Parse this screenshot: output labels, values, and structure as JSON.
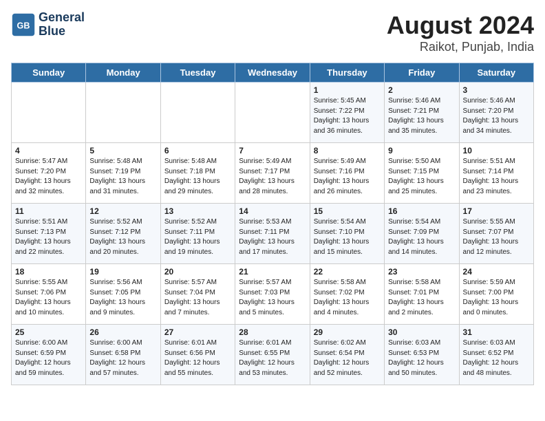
{
  "header": {
    "logo_line1": "General",
    "logo_line2": "Blue",
    "title": "August 2024",
    "subtitle": "Raikot, Punjab, India"
  },
  "weekdays": [
    "Sunday",
    "Monday",
    "Tuesday",
    "Wednesday",
    "Thursday",
    "Friday",
    "Saturday"
  ],
  "weeks": [
    [
      {
        "day": "",
        "sunrise": "",
        "sunset": "",
        "daylight": ""
      },
      {
        "day": "",
        "sunrise": "",
        "sunset": "",
        "daylight": ""
      },
      {
        "day": "",
        "sunrise": "",
        "sunset": "",
        "daylight": ""
      },
      {
        "day": "",
        "sunrise": "",
        "sunset": "",
        "daylight": ""
      },
      {
        "day": "1",
        "sunrise": "Sunrise: 5:45 AM",
        "sunset": "Sunset: 7:22 PM",
        "daylight": "Daylight: 13 hours and 36 minutes."
      },
      {
        "day": "2",
        "sunrise": "Sunrise: 5:46 AM",
        "sunset": "Sunset: 7:21 PM",
        "daylight": "Daylight: 13 hours and 35 minutes."
      },
      {
        "day": "3",
        "sunrise": "Sunrise: 5:46 AM",
        "sunset": "Sunset: 7:20 PM",
        "daylight": "Daylight: 13 hours and 34 minutes."
      }
    ],
    [
      {
        "day": "4",
        "sunrise": "Sunrise: 5:47 AM",
        "sunset": "Sunset: 7:20 PM",
        "daylight": "Daylight: 13 hours and 32 minutes."
      },
      {
        "day": "5",
        "sunrise": "Sunrise: 5:48 AM",
        "sunset": "Sunset: 7:19 PM",
        "daylight": "Daylight: 13 hours and 31 minutes."
      },
      {
        "day": "6",
        "sunrise": "Sunrise: 5:48 AM",
        "sunset": "Sunset: 7:18 PM",
        "daylight": "Daylight: 13 hours and 29 minutes."
      },
      {
        "day": "7",
        "sunrise": "Sunrise: 5:49 AM",
        "sunset": "Sunset: 7:17 PM",
        "daylight": "Daylight: 13 hours and 28 minutes."
      },
      {
        "day": "8",
        "sunrise": "Sunrise: 5:49 AM",
        "sunset": "Sunset: 7:16 PM",
        "daylight": "Daylight: 13 hours and 26 minutes."
      },
      {
        "day": "9",
        "sunrise": "Sunrise: 5:50 AM",
        "sunset": "Sunset: 7:15 PM",
        "daylight": "Daylight: 13 hours and 25 minutes."
      },
      {
        "day": "10",
        "sunrise": "Sunrise: 5:51 AM",
        "sunset": "Sunset: 7:14 PM",
        "daylight": "Daylight: 13 hours and 23 minutes."
      }
    ],
    [
      {
        "day": "11",
        "sunrise": "Sunrise: 5:51 AM",
        "sunset": "Sunset: 7:13 PM",
        "daylight": "Daylight: 13 hours and 22 minutes."
      },
      {
        "day": "12",
        "sunrise": "Sunrise: 5:52 AM",
        "sunset": "Sunset: 7:12 PM",
        "daylight": "Daylight: 13 hours and 20 minutes."
      },
      {
        "day": "13",
        "sunrise": "Sunrise: 5:52 AM",
        "sunset": "Sunset: 7:11 PM",
        "daylight": "Daylight: 13 hours and 19 minutes."
      },
      {
        "day": "14",
        "sunrise": "Sunrise: 5:53 AM",
        "sunset": "Sunset: 7:11 PM",
        "daylight": "Daylight: 13 hours and 17 minutes."
      },
      {
        "day": "15",
        "sunrise": "Sunrise: 5:54 AM",
        "sunset": "Sunset: 7:10 PM",
        "daylight": "Daylight: 13 hours and 15 minutes."
      },
      {
        "day": "16",
        "sunrise": "Sunrise: 5:54 AM",
        "sunset": "Sunset: 7:09 PM",
        "daylight": "Daylight: 13 hours and 14 minutes."
      },
      {
        "day": "17",
        "sunrise": "Sunrise: 5:55 AM",
        "sunset": "Sunset: 7:07 PM",
        "daylight": "Daylight: 13 hours and 12 minutes."
      }
    ],
    [
      {
        "day": "18",
        "sunrise": "Sunrise: 5:55 AM",
        "sunset": "Sunset: 7:06 PM",
        "daylight": "Daylight: 13 hours and 10 minutes."
      },
      {
        "day": "19",
        "sunrise": "Sunrise: 5:56 AM",
        "sunset": "Sunset: 7:05 PM",
        "daylight": "Daylight: 13 hours and 9 minutes."
      },
      {
        "day": "20",
        "sunrise": "Sunrise: 5:57 AM",
        "sunset": "Sunset: 7:04 PM",
        "daylight": "Daylight: 13 hours and 7 minutes."
      },
      {
        "day": "21",
        "sunrise": "Sunrise: 5:57 AM",
        "sunset": "Sunset: 7:03 PM",
        "daylight": "Daylight: 13 hours and 5 minutes."
      },
      {
        "day": "22",
        "sunrise": "Sunrise: 5:58 AM",
        "sunset": "Sunset: 7:02 PM",
        "daylight": "Daylight: 13 hours and 4 minutes."
      },
      {
        "day": "23",
        "sunrise": "Sunrise: 5:58 AM",
        "sunset": "Sunset: 7:01 PM",
        "daylight": "Daylight: 13 hours and 2 minutes."
      },
      {
        "day": "24",
        "sunrise": "Sunrise: 5:59 AM",
        "sunset": "Sunset: 7:00 PM",
        "daylight": "Daylight: 13 hours and 0 minutes."
      }
    ],
    [
      {
        "day": "25",
        "sunrise": "Sunrise: 6:00 AM",
        "sunset": "Sunset: 6:59 PM",
        "daylight": "Daylight: 12 hours and 59 minutes."
      },
      {
        "day": "26",
        "sunrise": "Sunrise: 6:00 AM",
        "sunset": "Sunset: 6:58 PM",
        "daylight": "Daylight: 12 hours and 57 minutes."
      },
      {
        "day": "27",
        "sunrise": "Sunrise: 6:01 AM",
        "sunset": "Sunset: 6:56 PM",
        "daylight": "Daylight: 12 hours and 55 minutes."
      },
      {
        "day": "28",
        "sunrise": "Sunrise: 6:01 AM",
        "sunset": "Sunset: 6:55 PM",
        "daylight": "Daylight: 12 hours and 53 minutes."
      },
      {
        "day": "29",
        "sunrise": "Sunrise: 6:02 AM",
        "sunset": "Sunset: 6:54 PM",
        "daylight": "Daylight: 12 hours and 52 minutes."
      },
      {
        "day": "30",
        "sunrise": "Sunrise: 6:03 AM",
        "sunset": "Sunset: 6:53 PM",
        "daylight": "Daylight: 12 hours and 50 minutes."
      },
      {
        "day": "31",
        "sunrise": "Sunrise: 6:03 AM",
        "sunset": "Sunset: 6:52 PM",
        "daylight": "Daylight: 12 hours and 48 minutes."
      }
    ]
  ]
}
